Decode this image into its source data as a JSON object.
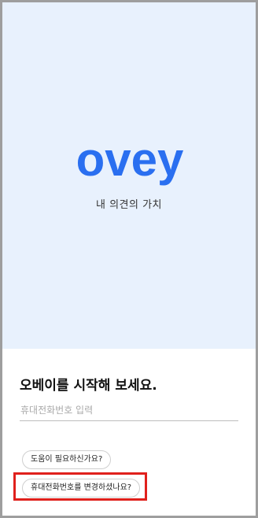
{
  "brand": {
    "logo_text": "ovey",
    "logo_color": "#2a6ff0",
    "tagline": "내 의견의 가치"
  },
  "signup": {
    "headline": "오베이를 시작해 보세요.",
    "phone_placeholder": "휴대전화번호 입력",
    "help_link": "도움이 필요하신가요?",
    "change_phone_link": "휴대전화번호를 변경하셨나요?"
  },
  "colors": {
    "hero_background": "#e8f1fd",
    "highlight_box": "#e0201c"
  }
}
